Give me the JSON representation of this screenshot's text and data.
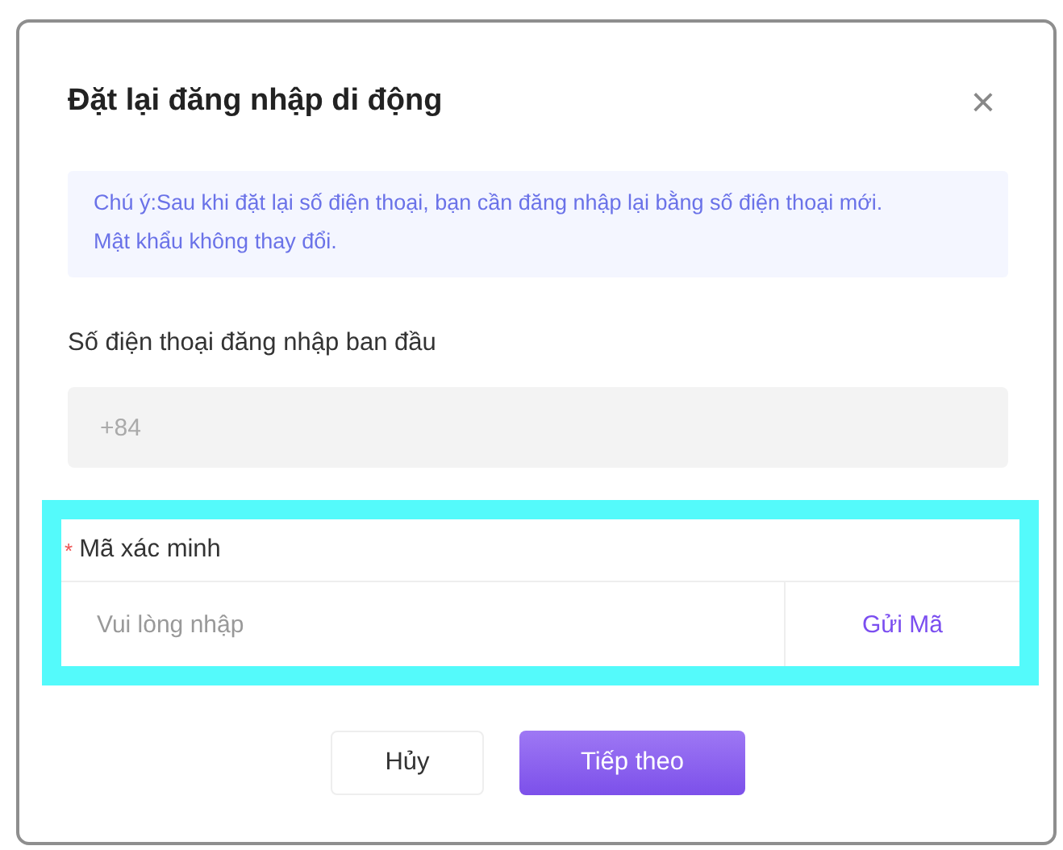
{
  "dialog": {
    "title": "Đặt lại đăng nhập di động",
    "close": "×"
  },
  "notice": "Chú ý:Sau khi đặt lại số điện thoại, bạn cần đăng nhập lại bằng số điện thoại mới. Mật khẩu không thay đổi.",
  "original_phone": {
    "label": "Số điện thoại đăng nhập ban đầu",
    "value": "+84",
    "disabled": true
  },
  "verification": {
    "required_mark": "*",
    "label": "Mã xác minh",
    "placeholder": "Vui lòng nhập",
    "send_button": "Gửi Mã",
    "highlighted": true
  },
  "buttons": [
    {
      "label": "Hủy",
      "kind": "secondary"
    },
    {
      "label": "Tiếp theo",
      "kind": "primary"
    }
  ]
}
